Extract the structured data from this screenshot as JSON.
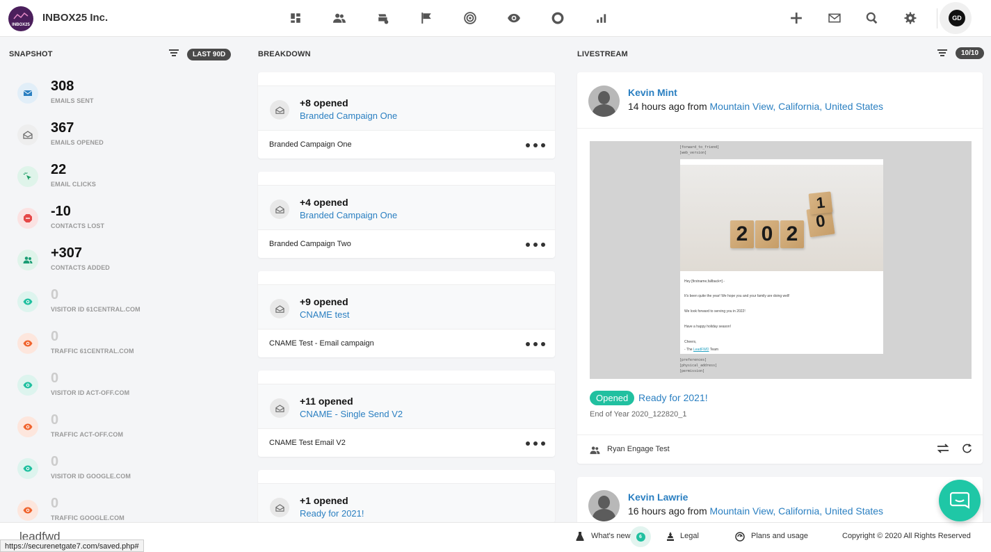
{
  "header": {
    "logo_text": "INBOX25",
    "company": "INBOX25 Inc.",
    "avatar_initials": "GD"
  },
  "snapshot": {
    "title": "SNAPSHOT",
    "range": "LAST 90D",
    "stats": [
      {
        "value": "308",
        "label": "EMAILS SENT"
      },
      {
        "value": "367",
        "label": "EMAILS OPENED"
      },
      {
        "value": "22",
        "label": "EMAIL CLICKS"
      },
      {
        "value": "-10",
        "label": "CONTACTS LOST"
      },
      {
        "value": "+307",
        "label": "CONTACTS ADDED"
      },
      {
        "value": "0",
        "label": "VISITOR ID 61CENTRAL.COM"
      },
      {
        "value": "0",
        "label": "TRAFFIC 61CENTRAL.COM"
      },
      {
        "value": "0",
        "label": "VISITOR ID ACT-OFF.COM"
      },
      {
        "value": "0",
        "label": "TRAFFIC ACT-OFF.COM"
      },
      {
        "value": "0",
        "label": "VISITOR ID GOOGLE.COM"
      },
      {
        "value": "0",
        "label": "TRAFFIC GOOGLE.COM"
      }
    ]
  },
  "breakdown": {
    "title": "BREAKDOWN",
    "cards": [
      {
        "opened": "+8 opened",
        "campaign": "Branded Campaign One",
        "name": "Branded Campaign One"
      },
      {
        "opened": "+4 opened",
        "campaign": "Branded Campaign One",
        "name": "Branded Campaign Two"
      },
      {
        "opened": "+9 opened",
        "campaign": "CNAME test",
        "name": "CNAME Test - Email campaign"
      },
      {
        "opened": "+11 opened",
        "campaign": "CNAME - Single Send V2",
        "name": "CNAME Test Email V2"
      },
      {
        "opened": "+1 opened",
        "campaign": "Ready for 2021!",
        "name": ""
      }
    ]
  },
  "livestream": {
    "title": "LIVESTREAM",
    "count": "10/10",
    "items": [
      {
        "name": "Kevin Mint",
        "time": "14 hours ago from",
        "location": "Mountain View, California, United States",
        "preview": {
          "tag1": "[forward_to_friend]",
          "tag2": "[web_version]",
          "greeting": "Hey [firstname,fallback=] -",
          "line1": "It's been quite the year! We hope you and your family are doing well!",
          "line2": "We look forward to serving you in 2022!",
          "line3": "Have a happy holiday season!",
          "line4": "Cheers,",
          "line5a": "- The",
          "line5b": "LeadFWD",
          "line5c": "Team",
          "tag3": "[preferences]",
          "tag4": "[physical_address]",
          "tag5": "[permission]"
        },
        "badge": "Opened",
        "subject": "Ready for 2021!",
        "campaign": "End of Year 2020_122820_1",
        "list": "Ryan Engage Test"
      },
      {
        "name": "Kevin Lawrie",
        "time": "16 hours ago from",
        "location": "Mountain View, California, United States"
      }
    ]
  },
  "footer": {
    "brand": "leadfwd",
    "whats_new": "What's new",
    "whats_new_count": "6",
    "legal": "Legal",
    "plans": "Plans and usage",
    "copyright": "Copyright © 2020 All Rights Reserved",
    "status_url": "https://securenetgate7.com/saved.php#"
  },
  "colors": {
    "accent": "#2a7fc1",
    "teal": "#21c0a0",
    "brand_purple": "#4b1f5c"
  }
}
